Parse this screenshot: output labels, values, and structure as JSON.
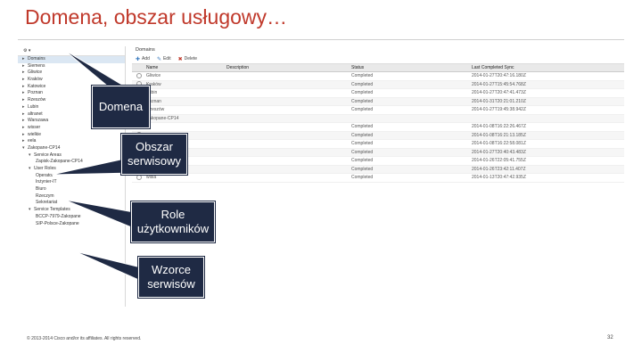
{
  "slide": {
    "title": "Domena, obszar usługowy…",
    "footer": "© 2013-2014 Cisco and/or its affiliates. All rights reserved.",
    "page_number": "32"
  },
  "tree": {
    "items": [
      {
        "label": "Domains",
        "level": 0,
        "selected": true
      },
      {
        "label": "Siemens",
        "level": 0
      },
      {
        "label": "Gliwice",
        "level": 0
      },
      {
        "label": "Kraków",
        "level": 0
      },
      {
        "label": "Katowice",
        "level": 0
      },
      {
        "label": "Poznan",
        "level": 0
      },
      {
        "label": "Rzeszów",
        "level": 0
      },
      {
        "label": "Lubin",
        "level": 0
      },
      {
        "label": "altranet",
        "level": 0
      },
      {
        "label": "Warszawa",
        "level": 0
      },
      {
        "label": "wisser",
        "level": 0
      },
      {
        "label": "wielkie",
        "level": 0
      },
      {
        "label": "eela",
        "level": 0
      },
      {
        "label": "Zakopane-CP14",
        "level": 0
      },
      {
        "label": "Service Areas",
        "level": 1
      },
      {
        "label": "Zapisk-Zakopane-CP14",
        "level": 2
      },
      {
        "label": "User Roles",
        "level": 1
      },
      {
        "label": "Operator",
        "level": 2
      },
      {
        "label": "Inżynier-IT",
        "level": 2
      },
      {
        "label": "Biuro",
        "level": 2
      },
      {
        "label": "Rzeczym",
        "level": 2
      },
      {
        "label": "Sekretariat",
        "level": 2
      },
      {
        "label": "Service Templates",
        "level": 1
      },
      {
        "label": "BCCP-7979-Zakopane",
        "level": 2
      },
      {
        "label": "SIP-Polsce-Zakopane",
        "level": 2
      }
    ]
  },
  "domains_panel": {
    "title": "Domains",
    "toolbar": {
      "add": "Add",
      "edit": "Edit",
      "delete": "Delete"
    },
    "columns": [
      "Name",
      "Description",
      "Status",
      "Last Completed Sync"
    ],
    "rows": [
      {
        "name": "Gliwice",
        "status": "Completed",
        "sync": "2014-01-27T20:47:16.180Z"
      },
      {
        "name": "Kraków",
        "status": "Completed",
        "sync": "2014-01-27T15:45:54.768Z"
      },
      {
        "name": "Lubin",
        "status": "Completed",
        "sync": "2014-01-27T20:47:41.473Z"
      },
      {
        "name": "Poznan",
        "status": "Completed",
        "sync": "2014-01-31T20:21:01.210Z"
      },
      {
        "name": "Rzeszów",
        "status": "Completed",
        "sync": "2014-01-27T19:45:38.942Z"
      },
      {
        "name": "Zakopane-CP14",
        "status": "",
        "sync": ""
      },
      {
        "name": "",
        "status": "Completed",
        "sync": "2014-01-08T16:22:26.467Z"
      },
      {
        "name": "",
        "status": "Completed",
        "sync": "2014-01-08T16:21:13.185Z"
      },
      {
        "name": "",
        "status": "Completed",
        "sync": "2014-01-08T16:22:58.081Z"
      },
      {
        "name": "",
        "status": "Completed",
        "sync": "2014-01-27T20:40:43.483Z"
      },
      {
        "name": "",
        "status": "Completed",
        "sync": "2014-01-26T22:05:41.755Z"
      },
      {
        "name": "",
        "status": "Completed",
        "sync": "2014-01-26T23:42:11.407Z"
      },
      {
        "name": "wisla",
        "status": "Completed",
        "sync": "2014-01-13T20:47:42.935Z"
      }
    ]
  },
  "callouts": {
    "domena": "Domena",
    "obszar": [
      "Obszar",
      "serwisowy"
    ],
    "role": [
      "Role",
      "użytkowników"
    ],
    "wzorce": [
      "Wzorce",
      "serwisów"
    ]
  },
  "colors": {
    "title": "#c0392b",
    "callout_bg": "#1f2a44"
  }
}
